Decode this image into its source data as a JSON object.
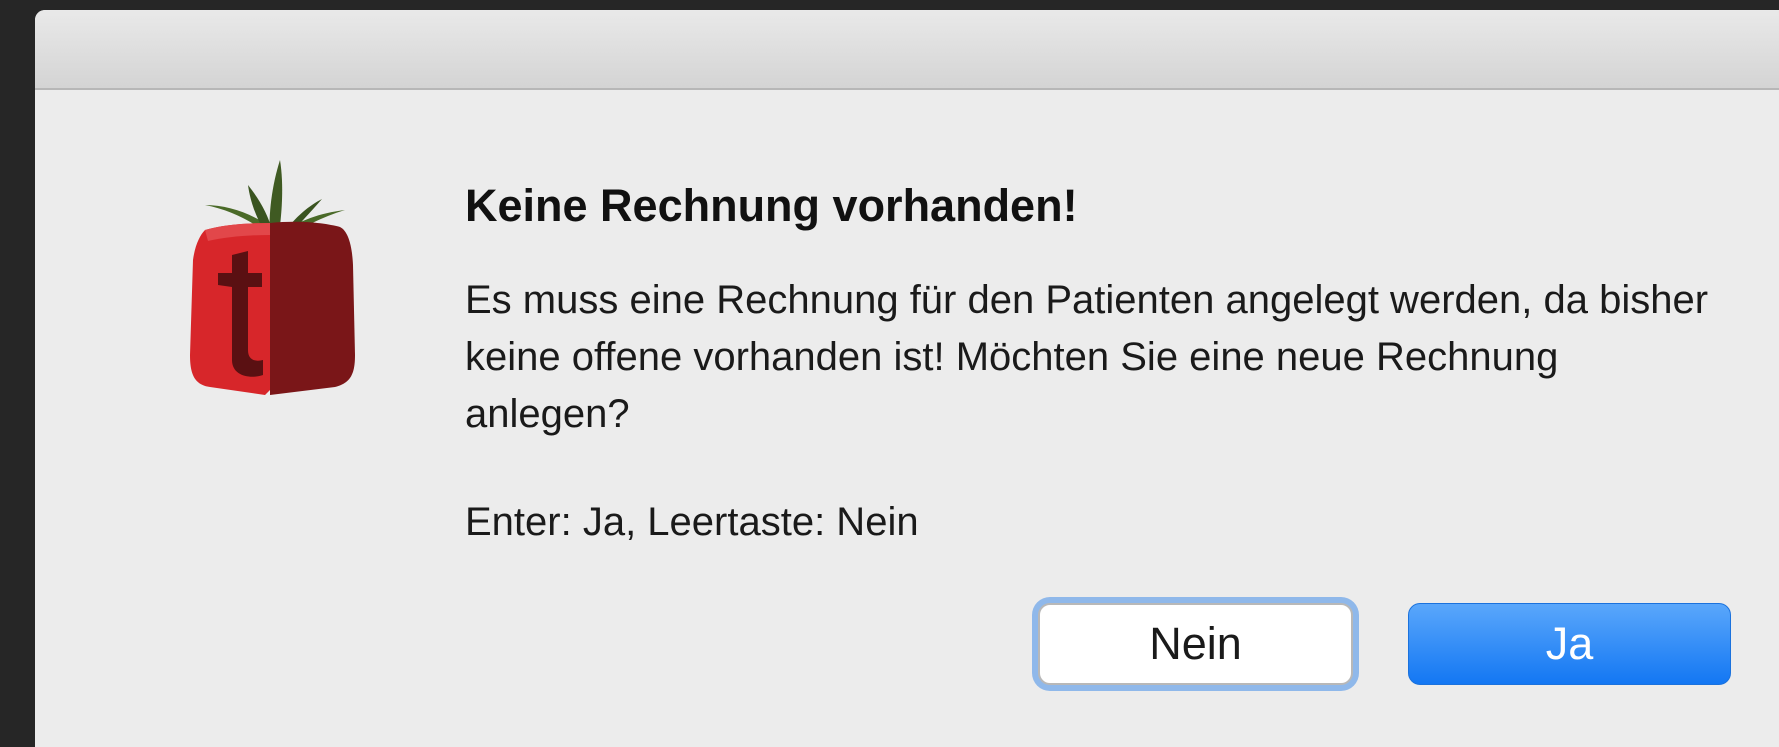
{
  "dialog": {
    "title": "Keine Rechnung vorhanden!",
    "message": "Es muss eine Rechnung für den Patienten angelegt werden, da bisher keine offene vorhanden ist! Möchten Sie eine neue Rechnung anlegen?",
    "hint": "Enter: Ja, Leertaste: Nein",
    "icon": "tomato-t-app-icon",
    "buttons": {
      "no_label": "Nein",
      "yes_label": "Ja"
    },
    "colors": {
      "primary_button": "#1a7ff5",
      "focus_ring": "#8fb8ea",
      "background": "#ececec"
    }
  }
}
